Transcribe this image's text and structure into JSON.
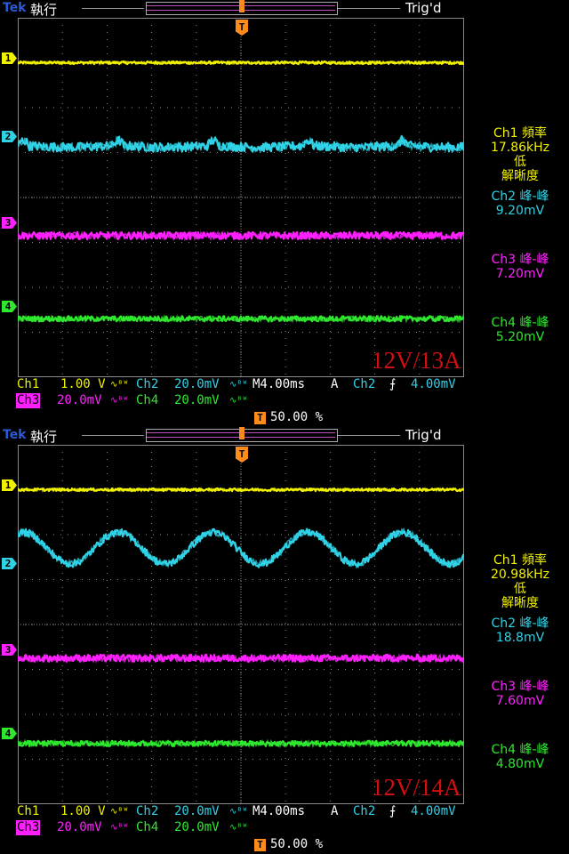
{
  "colors": {
    "ch1": "#f2f200",
    "ch2": "#30d2e6",
    "ch3": "#ff20ff",
    "ch4": "#2ee82e",
    "trigger": "#ff8c1a",
    "grid": "#8a8a8a",
    "annotation": "#d01010"
  },
  "screens": [
    {
      "status": {
        "brand": "Tek",
        "run_state": "執行",
        "trig_state": "Trig'd"
      },
      "annotation": "12V/13A",
      "channel_markers": [
        "1",
        "2",
        "3",
        "4"
      ],
      "measurements": [
        {
          "lines": [
            "Ch1 頻率",
            "17.86kHz",
            "低",
            "解晰度"
          ],
          "color": "ch1"
        },
        {
          "lines": [
            "Ch2 峰-峰",
            "9.20mV"
          ],
          "color": "ch2"
        },
        {
          "lines": [
            "Ch3 峰-峰",
            "7.20mV"
          ],
          "color": "ch3"
        },
        {
          "lines": [
            "Ch4 峰-峰",
            "5.20mV"
          ],
          "color": "ch4"
        }
      ],
      "readout": {
        "ch1": "Ch1",
        "ch1_scale": "1.00 V",
        "ch2": "Ch2",
        "ch2_scale": "20.0mV",
        "ch3": "Ch3",
        "ch3_scale": "20.0mV",
        "ch4": "Ch4",
        "ch4_scale": "20.0mV",
        "timebase": "M4.00ms",
        "trig_mode": "A",
        "trig_source": "Ch2",
        "trig_level": "4.00mV",
        "trig_position": "50.00 %",
        "trig_icon": "T"
      }
    },
    {
      "status": {
        "brand": "Tek",
        "run_state": "執行",
        "trig_state": "Trig'd"
      },
      "annotation": "12V/14A",
      "channel_markers": [
        "1",
        "2",
        "3",
        "4"
      ],
      "measurements": [
        {
          "lines": [
            "Ch1 頻率",
            "20.98kHz",
            "低",
            "解晰度"
          ],
          "color": "ch1"
        },
        {
          "lines": [
            "Ch2 峰-峰",
            "18.8mV"
          ],
          "color": "ch2"
        },
        {
          "lines": [
            "Ch3 峰-峰",
            "7.60mV"
          ],
          "color": "ch3"
        },
        {
          "lines": [
            "Ch4 峰-峰",
            "4.80mV"
          ],
          "color": "ch4"
        }
      ],
      "readout": {
        "ch1": "Ch1",
        "ch1_scale": "1.00 V",
        "ch2": "Ch2",
        "ch2_scale": "20.0mV",
        "ch3": "Ch3",
        "ch3_scale": "20.0mV",
        "ch4": "Ch4",
        "ch4_scale": "20.0mV",
        "timebase": "M4.00ms",
        "trig_mode": "A",
        "trig_source": "Ch2",
        "trig_level": "4.00mV",
        "trig_position": "50.00 %",
        "trig_icon": "T"
      }
    }
  ],
  "chart_data": [
    {
      "type": "line",
      "title": "12V/13A",
      "x_unit_per_div": "4.00ms",
      "xlim": [
        0,
        40
      ],
      "x_divisions": 10,
      "y_divisions": 8,
      "grid": true,
      "series": [
        {
          "name": "Ch1",
          "level_div": 3.0,
          "scale": "1.00 V",
          "noise_div": 0.03,
          "waveform": "flat",
          "pk_pk": ""
        },
        {
          "name": "Ch2",
          "level_div": 1.15,
          "scale": "20.0mV",
          "noise_div": 0.1,
          "waveform": "ripple",
          "pk_pk": "9.20mV",
          "ripple_period_ms": 8.5,
          "ripple_amp_div": 0.12
        },
        {
          "name": "Ch3",
          "level_div": -0.85,
          "scale": "20.0mV",
          "noise_div": 0.08,
          "waveform": "flat",
          "pk_pk": "7.20mV"
        },
        {
          "name": "Ch4",
          "level_div": -2.7,
          "scale": "20.0mV",
          "noise_div": 0.06,
          "waveform": "flat",
          "pk_pk": "5.20mV"
        }
      ]
    },
    {
      "type": "line",
      "title": "12V/14A",
      "x_unit_per_div": "4.00ms",
      "xlim": [
        0,
        40
      ],
      "x_divisions": 10,
      "y_divisions": 8,
      "grid": true,
      "series": [
        {
          "name": "Ch1",
          "level_div": 3.0,
          "scale": "1.00 V",
          "noise_div": 0.03,
          "waveform": "flat",
          "pk_pk": ""
        },
        {
          "name": "Ch2",
          "level_div": 1.7,
          "scale": "20.0mV",
          "noise_div": 0.08,
          "waveform": "sine",
          "pk_pk": "18.8mV",
          "period_ms": 8.5,
          "amp_div": 0.35
        },
        {
          "name": "Ch3",
          "level_div": -0.75,
          "scale": "20.0mV",
          "noise_div": 0.08,
          "waveform": "flat",
          "pk_pk": "7.60mV"
        },
        {
          "name": "Ch4",
          "level_div": -2.65,
          "scale": "20.0mV",
          "noise_div": 0.06,
          "waveform": "flat",
          "pk_pk": "4.80mV"
        }
      ]
    }
  ]
}
